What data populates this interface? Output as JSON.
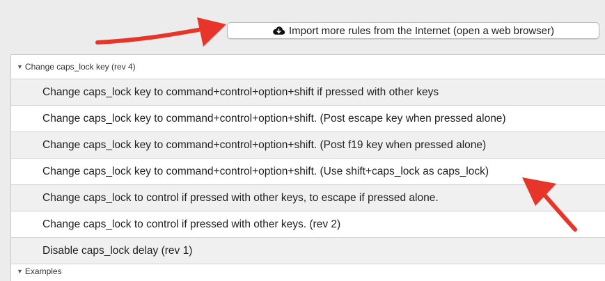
{
  "toolbar": {
    "import_button_label": "Import more rules from the Internet (open a web browser)",
    "import_icon": "cloud-download-icon"
  },
  "groups": [
    {
      "header": "Change caps_lock key (rev 4)",
      "expanded": true,
      "rules": [
        "Change caps_lock key to command+control+option+shift if pressed with other keys",
        "Change caps_lock key to command+control+option+shift. (Post escape key when pressed alone)",
        "Change caps_lock key to command+control+option+shift. (Post f19 key when pressed alone)",
        "Change caps_lock key to command+control+option+shift. (Use shift+caps_lock as caps_lock)",
        "Change caps_lock to control if pressed with other keys, to escape if pressed alone.",
        "Change caps_lock to control if pressed with other keys. (rev 2)",
        "Disable caps_lock delay (rev 1)"
      ]
    },
    {
      "header": "Examples",
      "expanded": true
    }
  ],
  "colors": {
    "annotation_arrow": "#e8352a",
    "row_alt": "#f0f0f0",
    "background": "#ececec"
  }
}
